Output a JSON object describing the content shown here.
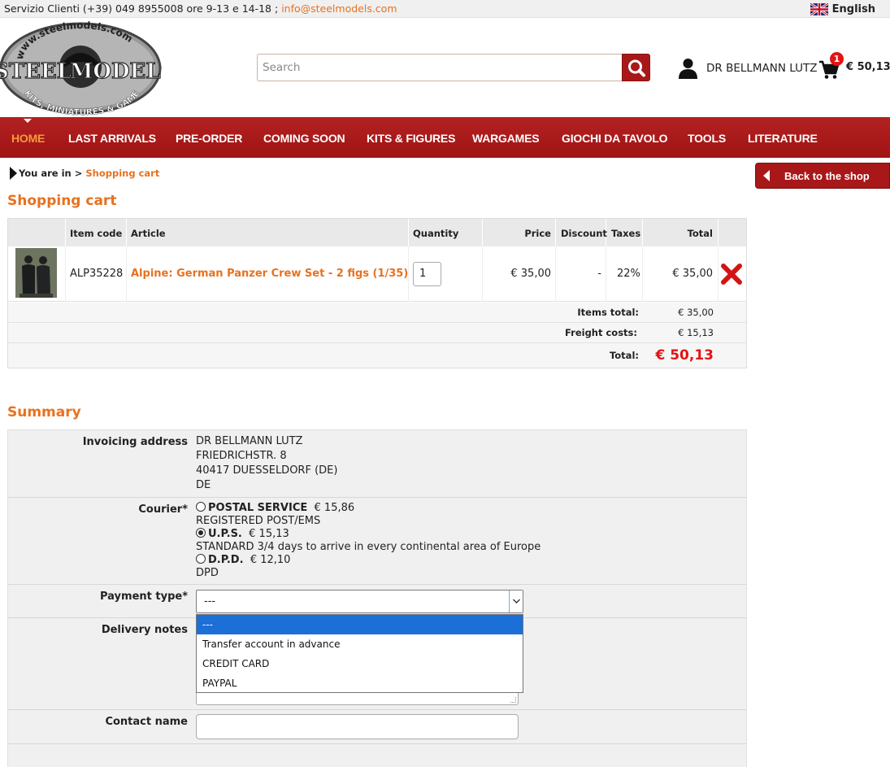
{
  "topbar": {
    "contact_text": "Servizio Clienti (+39) 049 8955008 ore 9-13 e 14-18 ;",
    "email": "info@steelmodels.com",
    "language": "English"
  },
  "logo": {
    "url_text": "www.steelmodels.com",
    "brand_left": "STEEL",
    "brand_right": "MODELS",
    "tagline": "KITS, MINIATURES & GAMES"
  },
  "search": {
    "placeholder": "Search"
  },
  "user": {
    "name": "DR BELLMANN LUTZ"
  },
  "cart": {
    "count": "1",
    "total": "€ 50,13"
  },
  "nav": [
    {
      "label": "HOME"
    },
    {
      "label": "LAST ARRIVALS"
    },
    {
      "label": "PRE-ORDER"
    },
    {
      "label": "COMING SOON"
    },
    {
      "label": "KITS & FIGURES"
    },
    {
      "label": "WARGAMES"
    },
    {
      "label": "GIOCHI DA TAVOLO"
    },
    {
      "label": "TOOLS"
    },
    {
      "label": "LITERATURE"
    }
  ],
  "breadcrumb": {
    "prefix": "You are in",
    "sep": ">",
    "current": "Shopping cart"
  },
  "back_button": "Back to the shop",
  "cart_title": "Shopping cart",
  "table": {
    "headers": {
      "code": "Item code",
      "article": "Article",
      "quantity": "Quantity",
      "price": "Price",
      "discount": "Discount",
      "taxes": "Taxes",
      "total": "Total"
    },
    "rows": [
      {
        "code": "ALP35228",
        "article": "Alpine: German Panzer Crew Set - 2 figs (1/35)",
        "quantity": "1",
        "price": "€ 35,00",
        "discount": "-",
        "taxes": "22%",
        "total": "€ 35,00"
      }
    ]
  },
  "totals": {
    "items_label": "Items total:",
    "items_value": "€ 35,00",
    "freight_label": "Freight costs:",
    "freight_value": "€ 15,13",
    "total_label": "Total:",
    "total_value": "€ 50,13"
  },
  "summary_title": "Summary",
  "summary": {
    "invoicing_label": "Invoicing address",
    "address": [
      "DR BELLMANN LUTZ",
      "FRIEDRICHSTR. 8",
      "40417 DUESSELDORF (DE)",
      "DE"
    ],
    "courier_label": "Courier*",
    "couriers": [
      {
        "name": "POSTAL SERVICE",
        "price": "€ 15,86",
        "desc": "REGISTERED POST/EMS",
        "selected": false
      },
      {
        "name": "U.P.S.",
        "price": "€ 15,13",
        "desc": "STANDARD 3/4 days to arrive in every continental area of Europe",
        "selected": true
      },
      {
        "name": "D.P.D.",
        "price": "€ 12,10",
        "desc": "DPD",
        "selected": false
      }
    ],
    "payment_label": "Payment type*",
    "payment_value": "---",
    "payment_options": [
      "---",
      "Transfer account in advance",
      "CREDIT CARD",
      "PAYPAL"
    ],
    "notes_label": "Delivery notes",
    "contact_label": "Contact name"
  },
  "colors": {
    "brand_red": "#a81818",
    "accent_orange": "#e8711e",
    "price_red": "#e21414"
  }
}
